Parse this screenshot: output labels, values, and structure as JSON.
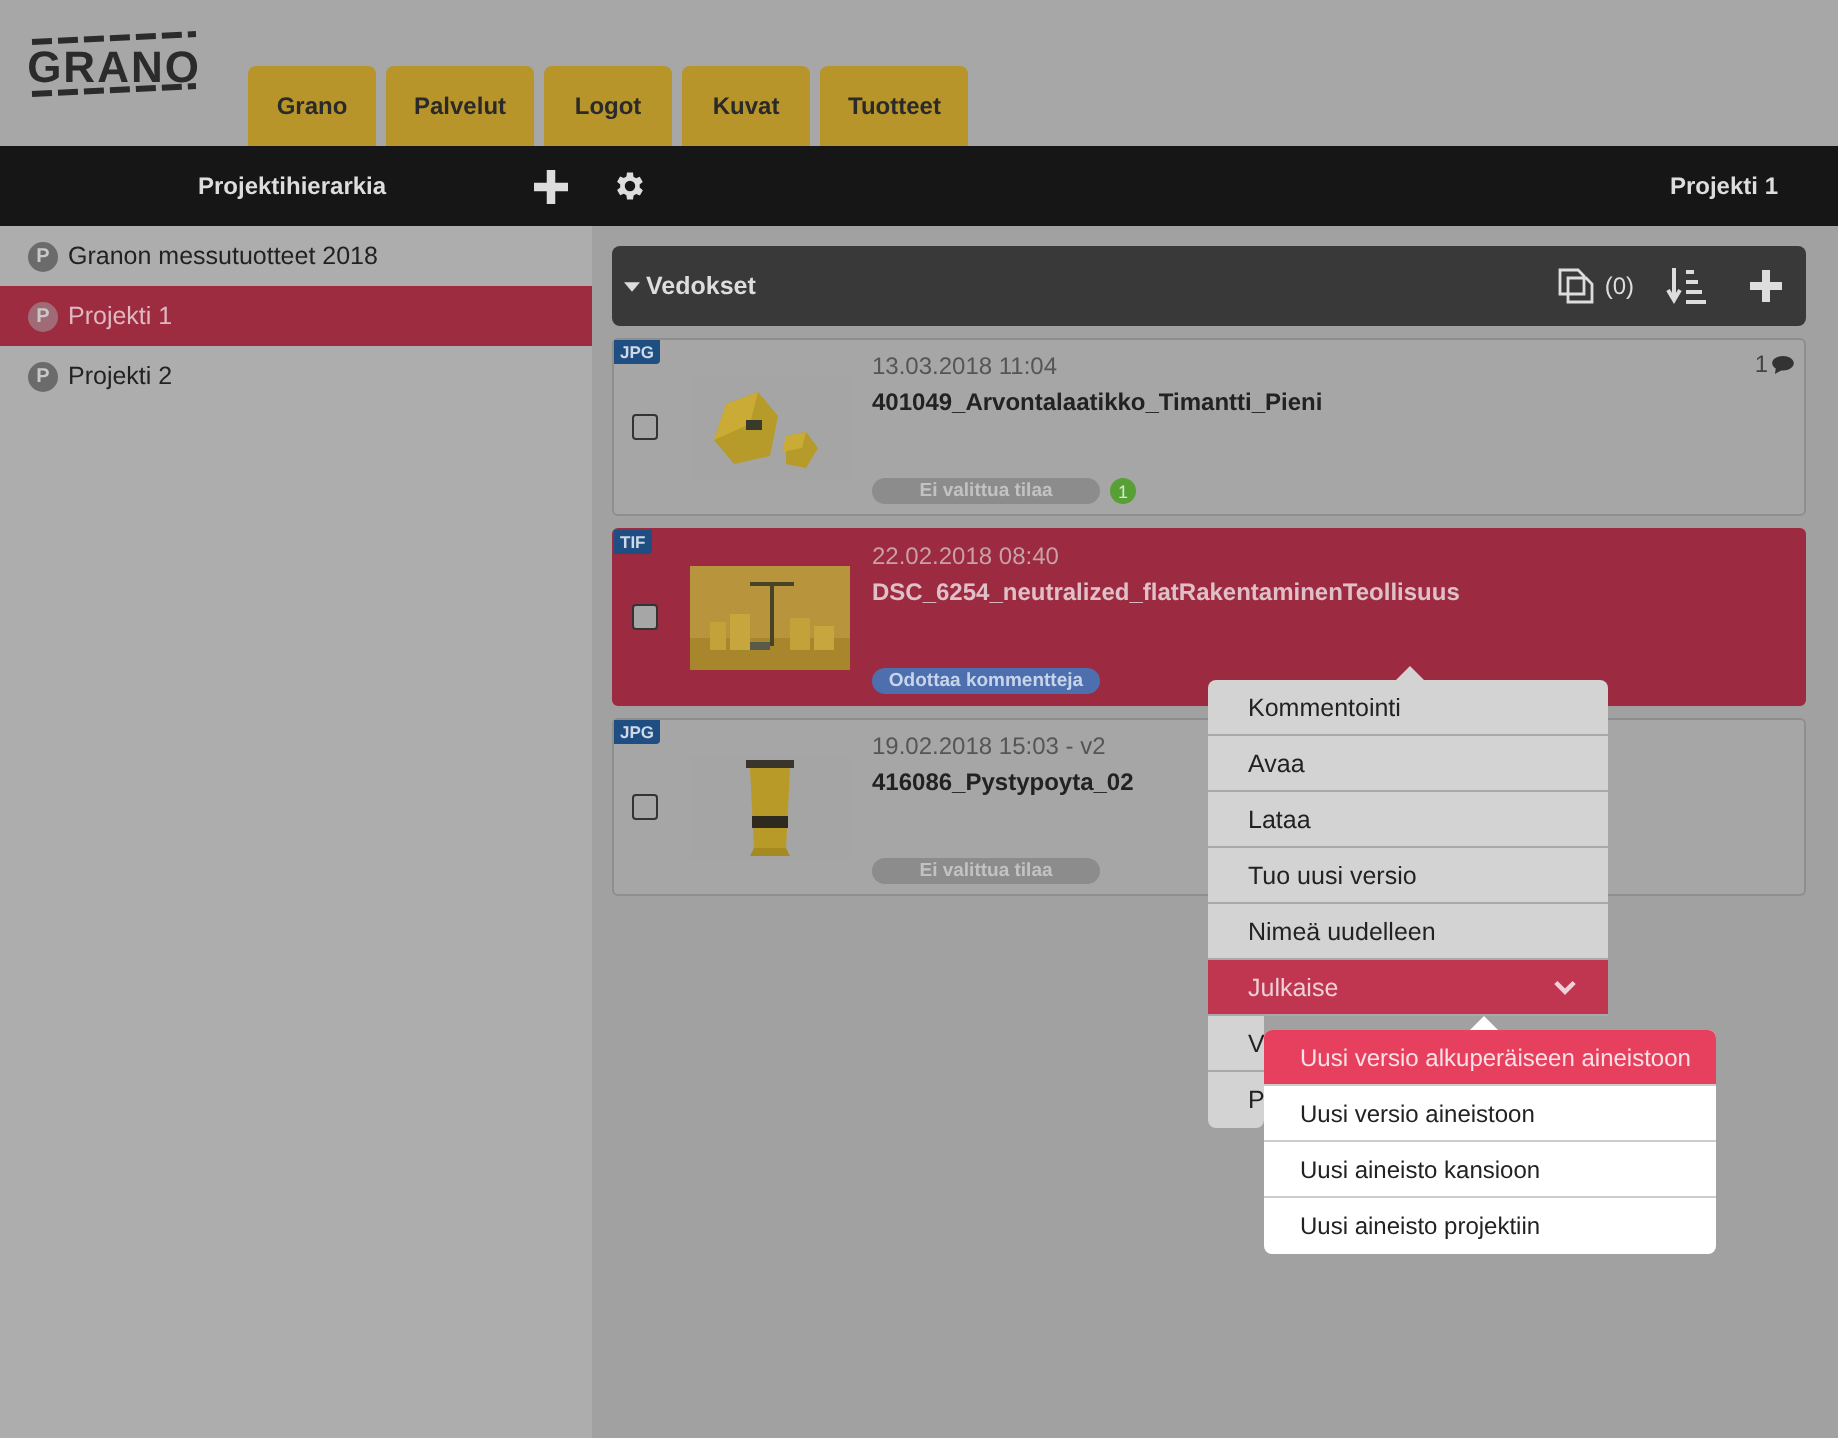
{
  "logo": "GRANO",
  "tabs": [
    {
      "label": "Grano",
      "selected": false
    },
    {
      "label": "Palvelut",
      "selected": false
    },
    {
      "label": "Logot",
      "selected": false
    },
    {
      "label": "Kuvat",
      "selected": false
    },
    {
      "label": "Tuotteet",
      "selected": false
    }
  ],
  "toolbar": {
    "title": "Projektihierarkia",
    "current_project": "Projekti 1"
  },
  "sidebar": {
    "items": [
      {
        "badge": "P",
        "label": "Granon messutuotteet 2018",
        "selected": false
      },
      {
        "badge": "P",
        "label": "Projekti 1",
        "selected": true
      },
      {
        "badge": "P",
        "label": "Projekti 2",
        "selected": false
      }
    ]
  },
  "panel": {
    "title": "Vedokset",
    "expanded": true,
    "compare_count": "(0)"
  },
  "cards": [
    {
      "format": "JPG",
      "date": "13.03.2018 11:04",
      "name": "401049_Arvontalaatikko_Timantti_Pieni",
      "status": "Ei valittua tilaa",
      "color": "#8c8c8c",
      "comment_count": "1",
      "badge": "1",
      "selected": false,
      "checked": false
    },
    {
      "format": "TIF",
      "date": "22.02.2018 08:40",
      "name": "DSC_6254_neutralized_flatRakentaminenTeollisuus",
      "status": "Odottaa kommentteja",
      "color": "#4d6fae",
      "selected": true,
      "checked": false
    },
    {
      "format": "JPG",
      "date": "19.02.2018 15:03 - v2",
      "name": "416086_Pystypoyta_02",
      "status": "Ei valittua tilaa",
      "color": "#8c8c8c",
      "selected": false,
      "checked": false
    }
  ],
  "context_menu": {
    "items": [
      {
        "label": "Kommentointi",
        "kind": "action",
        "selected": false
      },
      {
        "label": "Avaa",
        "kind": "action",
        "selected": false
      },
      {
        "label": "Lataa",
        "kind": "action",
        "selected": false
      },
      {
        "label": "Tuo uusi versio",
        "kind": "action",
        "selected": false
      },
      {
        "label": "Nimeä uudelleen",
        "kind": "action",
        "selected": false
      },
      {
        "label": "Julkaise",
        "kind": "submenu",
        "selected": true
      },
      {
        "label": "V",
        "kind": "action",
        "selected": false
      },
      {
        "label": "P",
        "kind": "action",
        "selected": false
      }
    ],
    "submenu": [
      {
        "label": "Uusi versio alkuperäiseen aineistoon",
        "selected": true
      },
      {
        "label": "Uusi versio aineistoon",
        "selected": false
      },
      {
        "label": "Uusi aineisto kansioon",
        "selected": false
      },
      {
        "label": "Uusi aineisto projektiin",
        "selected": false
      }
    ]
  }
}
